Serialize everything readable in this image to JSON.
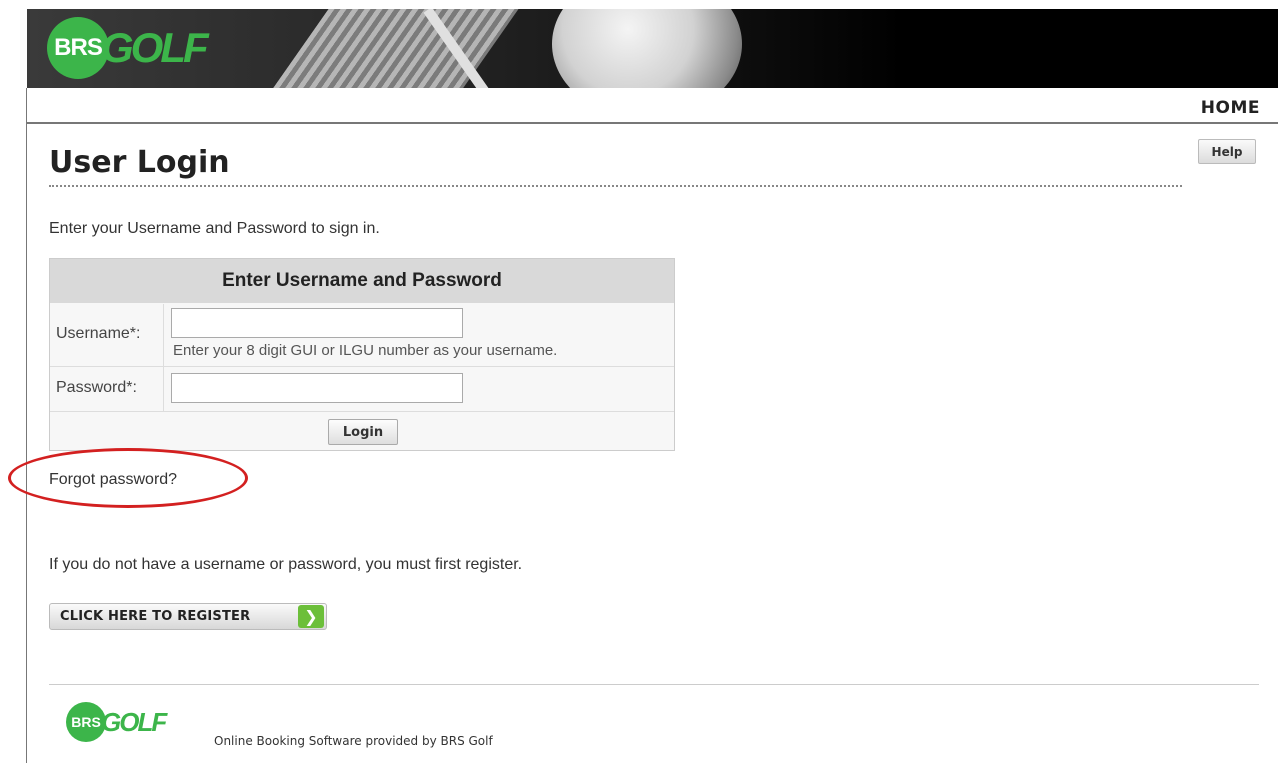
{
  "header": {
    "logo_circle_text": "BRS",
    "logo_word_text": "GOLF",
    "nav_home": "HOME"
  },
  "page": {
    "title": "User Login",
    "help_label": "Help",
    "intro": "Enter your Username and Password to sign in."
  },
  "login_form": {
    "heading": "Enter Username and Password",
    "username_label": "Username*:",
    "username_value": "",
    "username_hint": "Enter your 8 digit GUI or ILGU number as your username.",
    "password_label": "Password*:",
    "password_value": "",
    "login_button": "Login"
  },
  "links": {
    "forgot_password": "Forgot password?",
    "register_prompt": "If you do not have a username or password, you must first register.",
    "register_button": "CLICK HERE TO REGISTER"
  },
  "footer": {
    "logo_circle_text": "BRS",
    "logo_word_text": "GOLF",
    "credit": "Online Booking Software provided by BRS Golf"
  },
  "colors": {
    "brand_green": "#3cb54a",
    "annotation_red": "#d32020"
  }
}
